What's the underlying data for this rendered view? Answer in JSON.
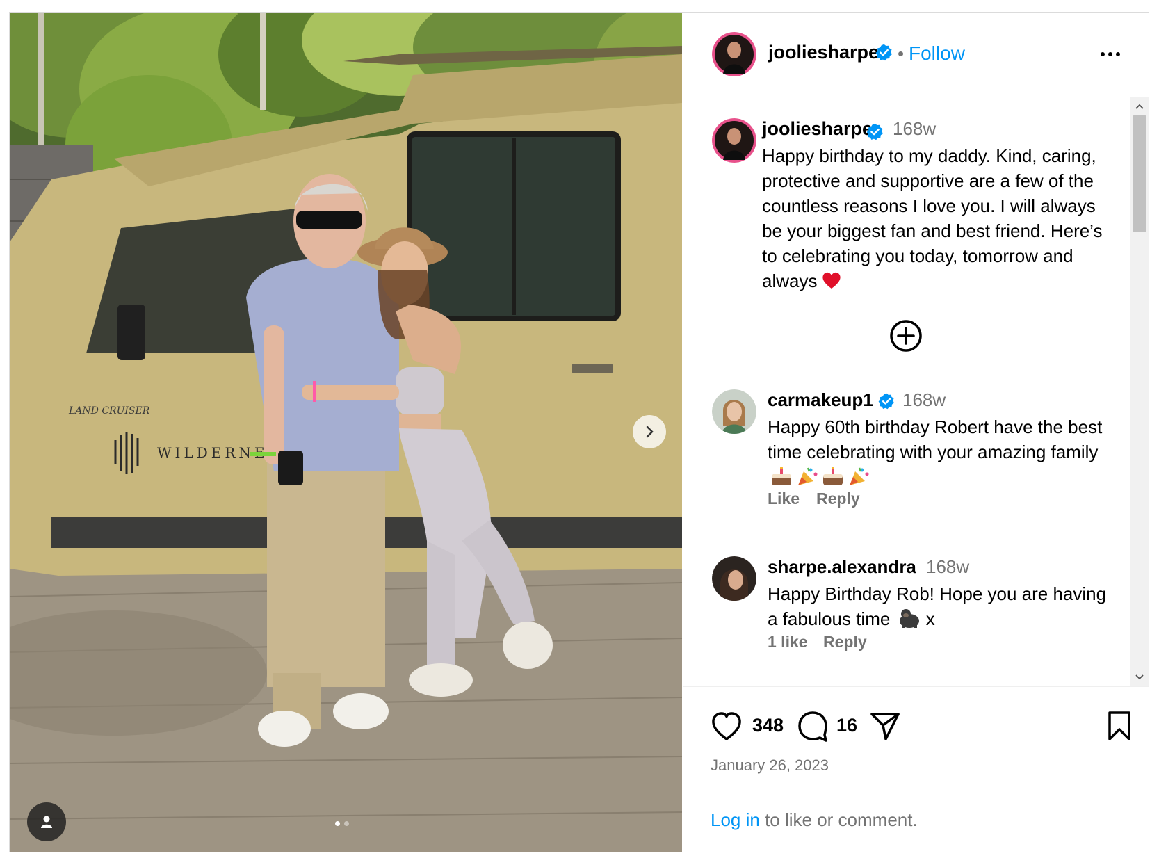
{
  "post": {
    "username": "jooliesharpe",
    "follow_label": "Follow",
    "separator": "•",
    "more_label": "More options"
  },
  "caption": {
    "username": "jooliesharpe",
    "time": "168w",
    "text": "Happy birthday to my daddy. Kind, caring, protective and supportive are a few of the countless reasons I love you. I will always be your biggest fan and best friend. Here’s to celebrating you today, tomorrow and always"
  },
  "comments": [
    {
      "username": "carmakeup1",
      "time": "168w",
      "text": "Happy 60th birthday Robert have the best time celebrating with your amazing family",
      "like_label": "Like",
      "reply_label": "Reply",
      "emojis": [
        "birthday-cake",
        "party-popper",
        "birthday-cake",
        "party-popper"
      ]
    },
    {
      "username": "sharpe.alexandra",
      "time": "168w",
      "text": "Happy Birthday Rob! Hope you are having a fabulous time",
      "text_suffix": "x",
      "like_label": "1 like",
      "reply_label": "Reply",
      "emojis": [
        "gorilla"
      ]
    }
  ],
  "actions": {
    "like_count": "348",
    "comment_count": "16",
    "date": "January 26, 2023"
  },
  "login": {
    "link_text": "Log in",
    "rest_text": " to like or comment."
  },
  "carousel": {
    "total_slides": 2,
    "current_slide": 1
  },
  "photo_signage": {
    "vehicle_model": "LAND CRUISER",
    "vehicle_brand_text": "WILDERNE"
  },
  "colors": {
    "link_blue": "#0095f6",
    "muted": "#737373",
    "verified_blue": "#0095f6",
    "heart_red": "#e0102a"
  }
}
